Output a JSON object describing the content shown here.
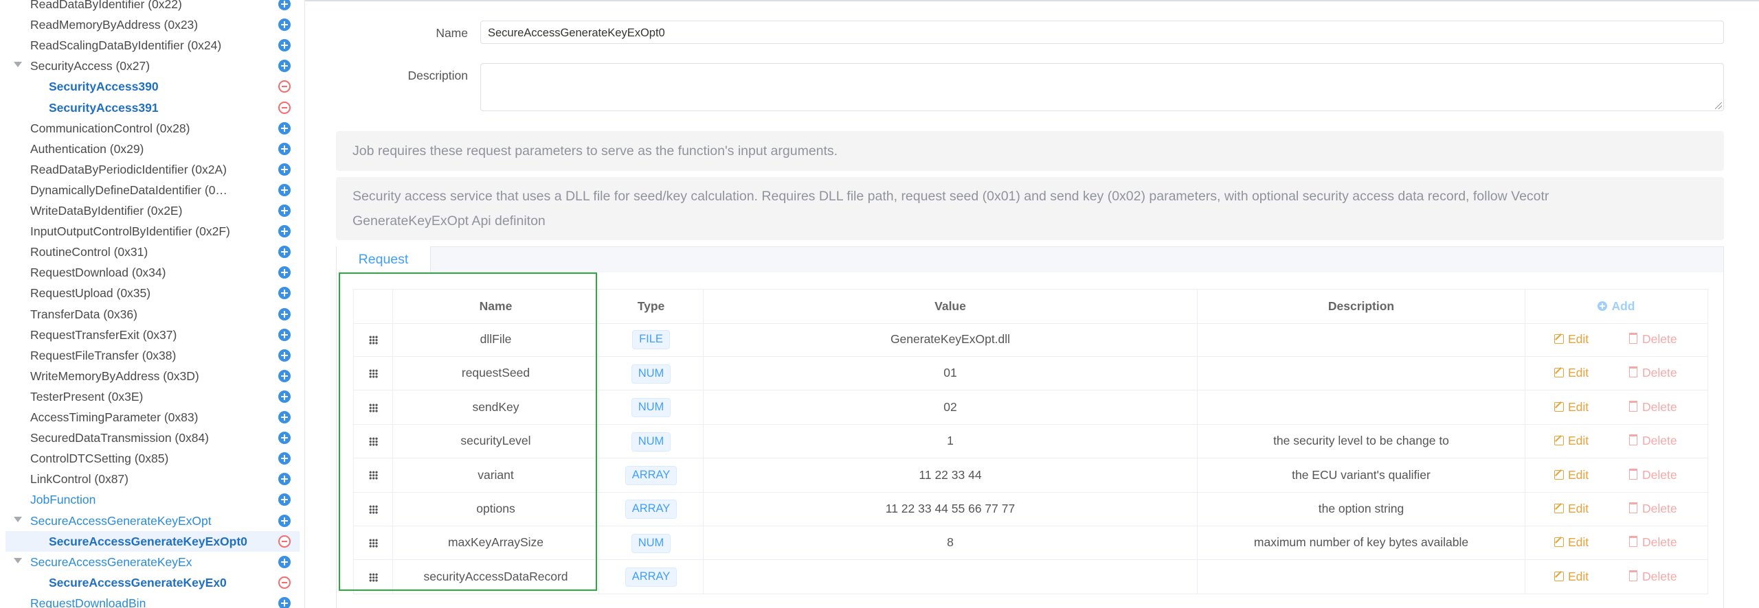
{
  "sidebar": {
    "items": [
      {
        "label": "ReadDataByIdentifier (0x22)",
        "style": "normal",
        "icon": "add"
      },
      {
        "label": "ReadMemoryByAddress (0x23)",
        "style": "normal",
        "icon": "add"
      },
      {
        "label": "ReadScalingDataByIdentifier (0x24)",
        "style": "normal",
        "icon": "add"
      },
      {
        "label": "SecurityAccess (0x27)",
        "style": "normal",
        "icon": "add",
        "expanded": true
      },
      {
        "label": "SecurityAccess390",
        "style": "bold",
        "icon": "remove",
        "child": true
      },
      {
        "label": "SecurityAccess391",
        "style": "bold",
        "icon": "remove",
        "child": true
      },
      {
        "label": "CommunicationControl (0x28)",
        "style": "normal",
        "icon": "add"
      },
      {
        "label": "Authentication (0x29)",
        "style": "normal",
        "icon": "add"
      },
      {
        "label": "ReadDataByPeriodicIdentifier (0x2A)",
        "style": "normal",
        "icon": "add"
      },
      {
        "label": "DynamicallyDefineDataIdentifier (0…",
        "style": "normal",
        "icon": "add"
      },
      {
        "label": "WriteDataByIdentifier (0x2E)",
        "style": "normal",
        "icon": "add"
      },
      {
        "label": "InputOutputControlByIdentifier (0x2F)",
        "style": "normal",
        "icon": "add"
      },
      {
        "label": "RoutineControl (0x31)",
        "style": "normal",
        "icon": "add"
      },
      {
        "label": "RequestDownload (0x34)",
        "style": "normal",
        "icon": "add"
      },
      {
        "label": "RequestUpload (0x35)",
        "style": "normal",
        "icon": "add"
      },
      {
        "label": "TransferData (0x36)",
        "style": "normal",
        "icon": "add"
      },
      {
        "label": "RequestTransferExit (0x37)",
        "style": "normal",
        "icon": "add"
      },
      {
        "label": "RequestFileTransfer (0x38)",
        "style": "normal",
        "icon": "add"
      },
      {
        "label": "WriteMemoryByAddress (0x3D)",
        "style": "normal",
        "icon": "add"
      },
      {
        "label": "TesterPresent (0x3E)",
        "style": "normal",
        "icon": "add"
      },
      {
        "label": "AccessTimingParameter (0x83)",
        "style": "normal",
        "icon": "add"
      },
      {
        "label": "SecuredDataTransmission (0x84)",
        "style": "normal",
        "icon": "add"
      },
      {
        "label": "ControlDTCSetting (0x85)",
        "style": "normal",
        "icon": "add"
      },
      {
        "label": "LinkControl (0x87)",
        "style": "normal",
        "icon": "add"
      },
      {
        "label": "JobFunction",
        "style": "link",
        "icon": "add"
      },
      {
        "label": "SecureAccessGenerateKeyExOpt",
        "style": "link",
        "icon": "add",
        "expanded": true
      },
      {
        "label": "SecureAccessGenerateKeyExOpt0",
        "style": "bold",
        "icon": "remove",
        "child": true,
        "selected": true
      },
      {
        "label": "SecureAccessGenerateKeyEx",
        "style": "link",
        "icon": "add",
        "expanded": true
      },
      {
        "label": "SecureAccessGenerateKeyEx0",
        "style": "bold",
        "icon": "remove",
        "child": true
      },
      {
        "label": "RequestDownloadBin",
        "style": "link",
        "icon": "add"
      }
    ]
  },
  "form": {
    "name_label": "Name",
    "name_value": "SecureAccessGenerateKeyExOpt0",
    "description_label": "Description",
    "description_value": ""
  },
  "info": {
    "job_note": "Job requires these request parameters to serve as the function's input arguments.",
    "service_note_line1": "Security access service that uses a DLL file for seed/key calculation. Requires DLL file path, request seed (0x01) and send key (0x02) parameters, with optional security access data record, follow Vecotr",
    "service_note_line2": "GenerateKeyExOpt Api definiton"
  },
  "tabs": {
    "request": "Request"
  },
  "table": {
    "headers": {
      "name": "Name",
      "type": "Type",
      "value": "Value",
      "description": "Description",
      "add": "Add"
    },
    "edit_label": "Edit",
    "delete_label": "Delete",
    "rows": [
      {
        "name": "dllFile",
        "type": "FILE",
        "value": "GenerateKeyExOpt.dll",
        "description": ""
      },
      {
        "name": "requestSeed",
        "type": "NUM",
        "value": "01",
        "description": ""
      },
      {
        "name": "sendKey",
        "type": "NUM",
        "value": "02",
        "description": ""
      },
      {
        "name": "securityLevel",
        "type": "NUM",
        "value": "1",
        "description": "the security level to be change to"
      },
      {
        "name": "variant",
        "type": "ARRAY",
        "value": "11 22 33 44",
        "description": "the ECU variant's qualifier"
      },
      {
        "name": "options",
        "type": "ARRAY",
        "value": "11 22 33 44 55 66 77 77",
        "description": "the option string"
      },
      {
        "name": "maxKeyArraySize",
        "type": "NUM",
        "value": "8",
        "description": "maximum number of key bytes available"
      },
      {
        "name": "securityAccessDataRecord",
        "type": "ARRAY",
        "value": "",
        "description": ""
      }
    ]
  },
  "colors": {
    "accent": "#409eff",
    "highlight_box": "#2daa3c",
    "edit": "#e6a23c",
    "delete": "#f5a8a8"
  }
}
